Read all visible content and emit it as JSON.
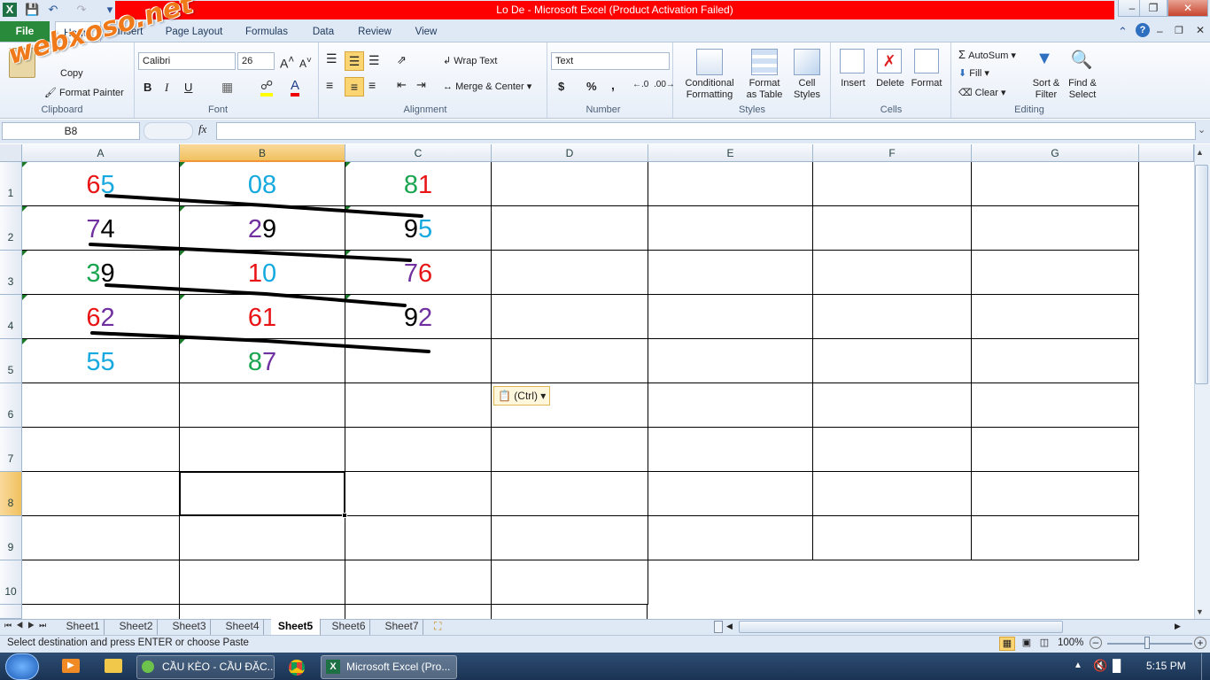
{
  "window": {
    "title": "Lo De  -  Microsoft Excel (Product Activation Failed)"
  },
  "watermark": "webxoso.net",
  "ribbon_tabs": [
    "File",
    "Home",
    "Insert",
    "Page Layout",
    "Formulas",
    "Data",
    "Review",
    "View"
  ],
  "clipboard": {
    "cut": "Cut",
    "copy": "Copy",
    "format_painter": "Format Painter",
    "group": "Clipboard"
  },
  "font": {
    "name": "Calibri",
    "size": "26",
    "bold": "B",
    "italic": "I",
    "underline": "U",
    "group": "Font"
  },
  "alignment": {
    "wrap": "Wrap Text",
    "merge": "Merge & Center",
    "group": "Alignment"
  },
  "number": {
    "format": "Text",
    "currency": "$",
    "percent": "%",
    "comma": ",",
    "group": "Number"
  },
  "styles": {
    "conditional": "Conditional",
    "formatting": "Formatting",
    "format_as": "Format",
    "as_table": "as Table",
    "cell": "Cell",
    "cell_styles": "Styles",
    "group": "Styles"
  },
  "cells": {
    "insert": "Insert",
    "delete": "Delete",
    "format": "Format",
    "group": "Cells"
  },
  "editing": {
    "autosum": "AutoSum",
    "fill": "Fill",
    "clear": "Clear",
    "sort1": "Sort &",
    "sort2": "Filter",
    "find1": "Find &",
    "find2": "Select",
    "group": "Editing"
  },
  "formula_bar": {
    "name_box": "B8",
    "fx": "fx",
    "formula": ""
  },
  "columns": [
    "A",
    "B",
    "C",
    "D",
    "E",
    "F",
    "G"
  ],
  "rows": [
    "1",
    "2",
    "3",
    "4",
    "5",
    "6",
    "7",
    "8",
    "9",
    "10"
  ],
  "cells_data": [
    [
      {
        "d1": "6",
        "c1": "#e81416",
        "d2": "5",
        "c2": "#16a9e0"
      },
      {
        "d1": "0",
        "c1": "#16a9e0",
        "d2": "8",
        "c2": "#16a9e0"
      },
      {
        "d1": "8",
        "c1": "#1aa550",
        "d2": "1",
        "c2": "#e81416"
      }
    ],
    [
      {
        "d1": "7",
        "c1": "#7030a0",
        "d2": "4",
        "c2": "#000000"
      },
      {
        "d1": "2",
        "c1": "#7030a0",
        "d2": "9",
        "c2": "#000000"
      },
      {
        "d1": "9",
        "c1": "#000000",
        "d2": "5",
        "c2": "#16a9e0"
      }
    ],
    [
      {
        "d1": "3",
        "c1": "#1aa550",
        "d2": "9",
        "c2": "#000000"
      },
      {
        "d1": "1",
        "c1": "#e81416",
        "d2": "0",
        "c2": "#16a9e0"
      },
      {
        "d1": "7",
        "c1": "#7030a0",
        "d2": "6",
        "c2": "#e81416"
      }
    ],
    [
      {
        "d1": "6",
        "c1": "#e81416",
        "d2": "2",
        "c2": "#7030a0"
      },
      {
        "d1": "6",
        "c1": "#e81416",
        "d2": "1",
        "c2": "#e81416"
      },
      {
        "d1": "9",
        "c1": "#000000",
        "d2": "2",
        "c2": "#7030a0"
      }
    ],
    [
      {
        "d1": "5",
        "c1": "#16a9e0",
        "d2": "5",
        "c2": "#16a9e0"
      },
      {
        "d1": "8",
        "c1": "#1aa550",
        "d2": "7",
        "c2": "#7030a0"
      },
      {
        "d1": "",
        "c1": "#000000",
        "d2": "",
        "c2": "#000000"
      }
    ]
  ],
  "paste_options": "(Ctrl)",
  "sheets": [
    "Sheet1",
    "Sheet2",
    "Sheet3",
    "Sheet4",
    "Sheet5",
    "Sheet6",
    "Sheet7"
  ],
  "active_sheet": "Sheet5",
  "status": {
    "message": "Select destination and press ENTER or choose Paste",
    "zoom": "100%"
  },
  "taskbar": {
    "items": [
      "CẦU KÈO - CẦU ĐẶC...",
      "Microsoft Excel (Pro..."
    ],
    "clock": "5:15 PM"
  }
}
